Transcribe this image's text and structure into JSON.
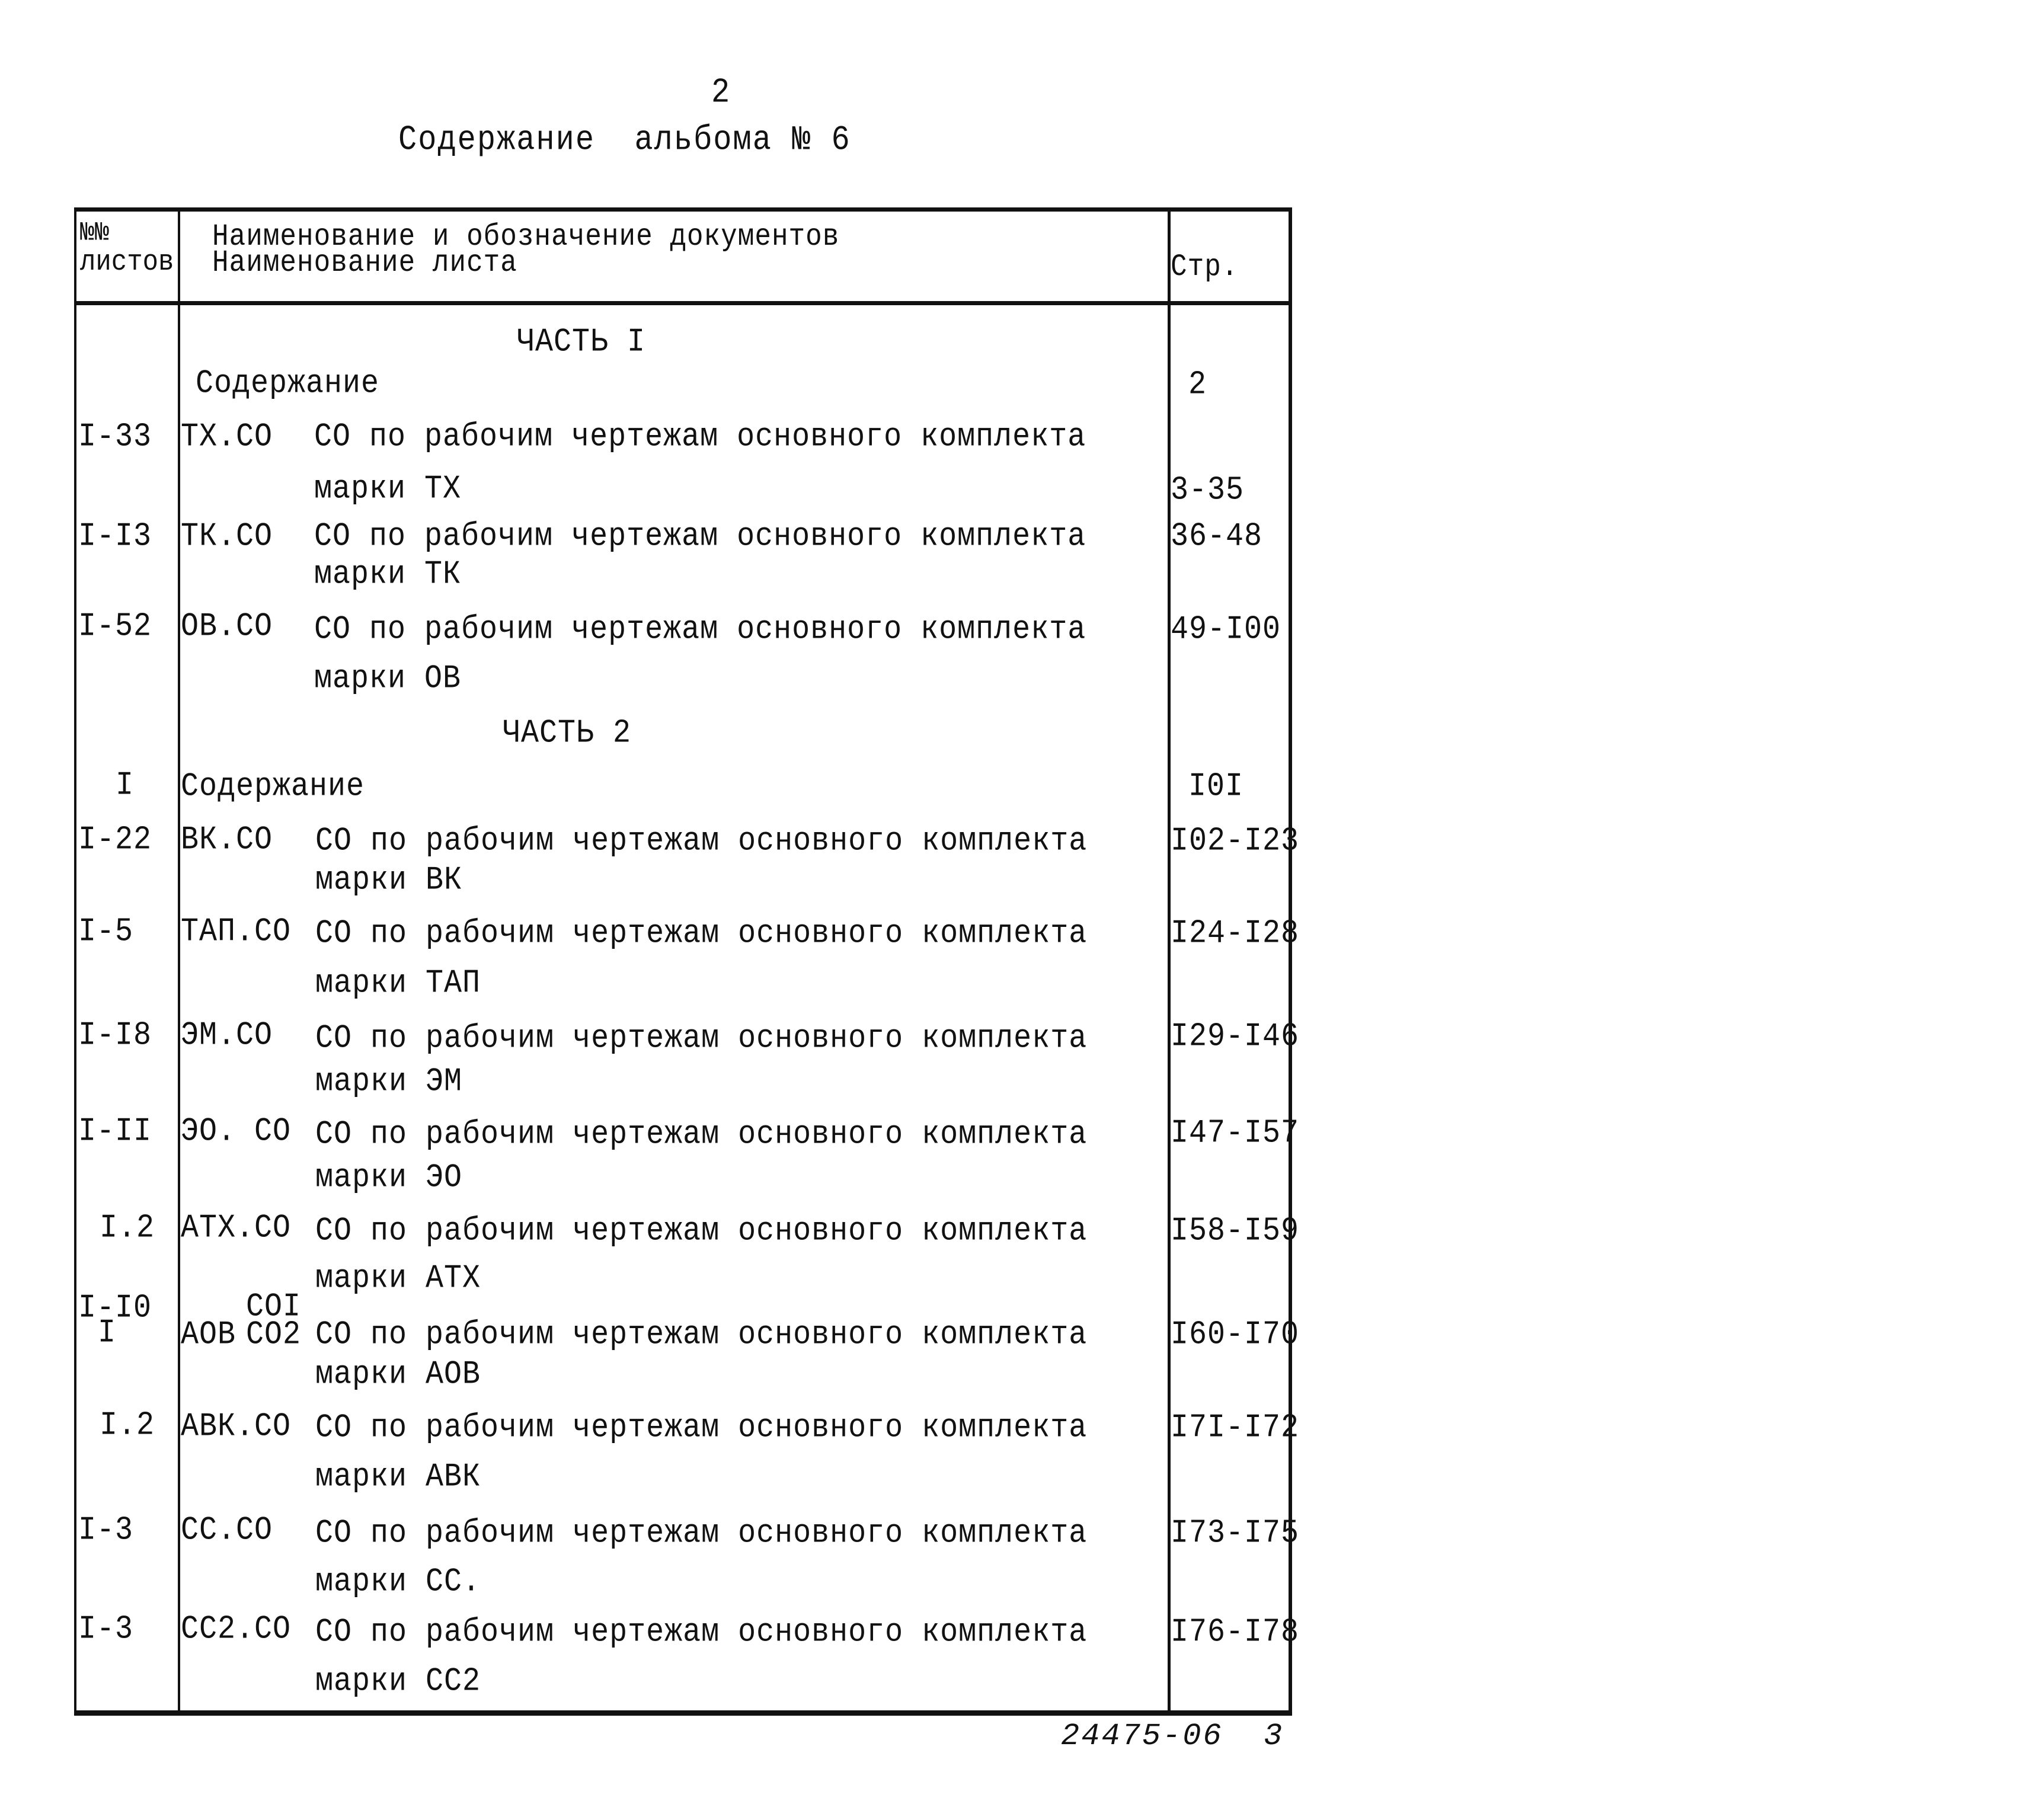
{
  "page_number": "2",
  "title": "Содержание  альбома № 6",
  "table": {
    "headers": {
      "col1_line1": "№№",
      "col1_line2": "листов",
      "col2_line1": "Наименование и обозначение документов",
      "col2_line2": "Наименование листа",
      "col3": "Стр."
    },
    "parts": [
      {
        "heading": "ЧАСТЬ I",
        "contents": {
          "sheets": "",
          "label": "Содержание",
          "pages": "2"
        },
        "rows": [
          {
            "sheets": "I-33",
            "code": "ТХ.СО",
            "line1": "СО по рабочим чертежам основного комплекта",
            "line2": "марки ТХ",
            "pages": "3-35"
          },
          {
            "sheets": "I-I3",
            "code": "ТК.СО",
            "line1": "СО по рабочим чертежам основного комплекта",
            "line2": "марки ТК",
            "pages": "36-48"
          },
          {
            "sheets": "I-52",
            "code": "ОВ.СО",
            "line1": "СО по рабочим чертежам основного комплекта",
            "line2": "марки ОВ",
            "pages": "49-I00"
          }
        ]
      },
      {
        "heading": "ЧАСТЬ 2",
        "contents": {
          "sheets": "I",
          "label": "Содержание",
          "pages": "I0I"
        },
        "rows": [
          {
            "sheets": "I-22",
            "code": "ВК.СО",
            "line1": "СО по рабочим чертежам основного комплекта",
            "line2": "марки ВК",
            "pages": "I02-I23"
          },
          {
            "sheets": "I-5",
            "code": "ТАП.СО",
            "line1": "СО по рабочим чертежам основного комплекта",
            "line2": "марки ТАП",
            "pages": "I24-I28"
          },
          {
            "sheets": "I-I8",
            "code": "ЭМ.СО",
            "line1": "СО по рабочим чертежам основного комплекта",
            "line2": "марки ЭМ",
            "pages": "I29-I46"
          },
          {
            "sheets": "I-II",
            "code": "ЭО. СО",
            "line1": "СО по рабочим чертежам основного комплекта",
            "line2": "марки ЭО",
            "pages": "I47-I57"
          },
          {
            "sheets": "I.2",
            "code": "АТХ.СО",
            "line1": "СО по рабочим чертежам основного комплекта",
            "line2": "марки АТХ",
            "pages": "I58-I59"
          },
          {
            "sheets": "I-I0",
            "sheets_sub": "I",
            "code": "АОВ",
            "code_sup": "СОI",
            "code_sub": "СО2",
            "line1": "СО по рабочим чертежам основного комплекта",
            "line2": "марки АОВ",
            "pages": "I60-I70"
          },
          {
            "sheets": "I.2",
            "code": "АВК.СО",
            "line1": "СО по рабочим чертежам основного комплекта",
            "line2": "марки АВК",
            "pages": "I7I-I72"
          },
          {
            "sheets": "I-3",
            "code": "СС.СО",
            "line1": "СО по рабочим чертежам основного комплекта",
            "line2": "марки СС.",
            "pages": "I73-I75"
          },
          {
            "sheets": "I-3",
            "code": "СС2.СО",
            "line1": "СО по рабочим чертежам основного комплекта",
            "line2": "марки СС2",
            "pages": "I76-I78"
          }
        ]
      }
    ]
  },
  "footer": "24475-06  3"
}
